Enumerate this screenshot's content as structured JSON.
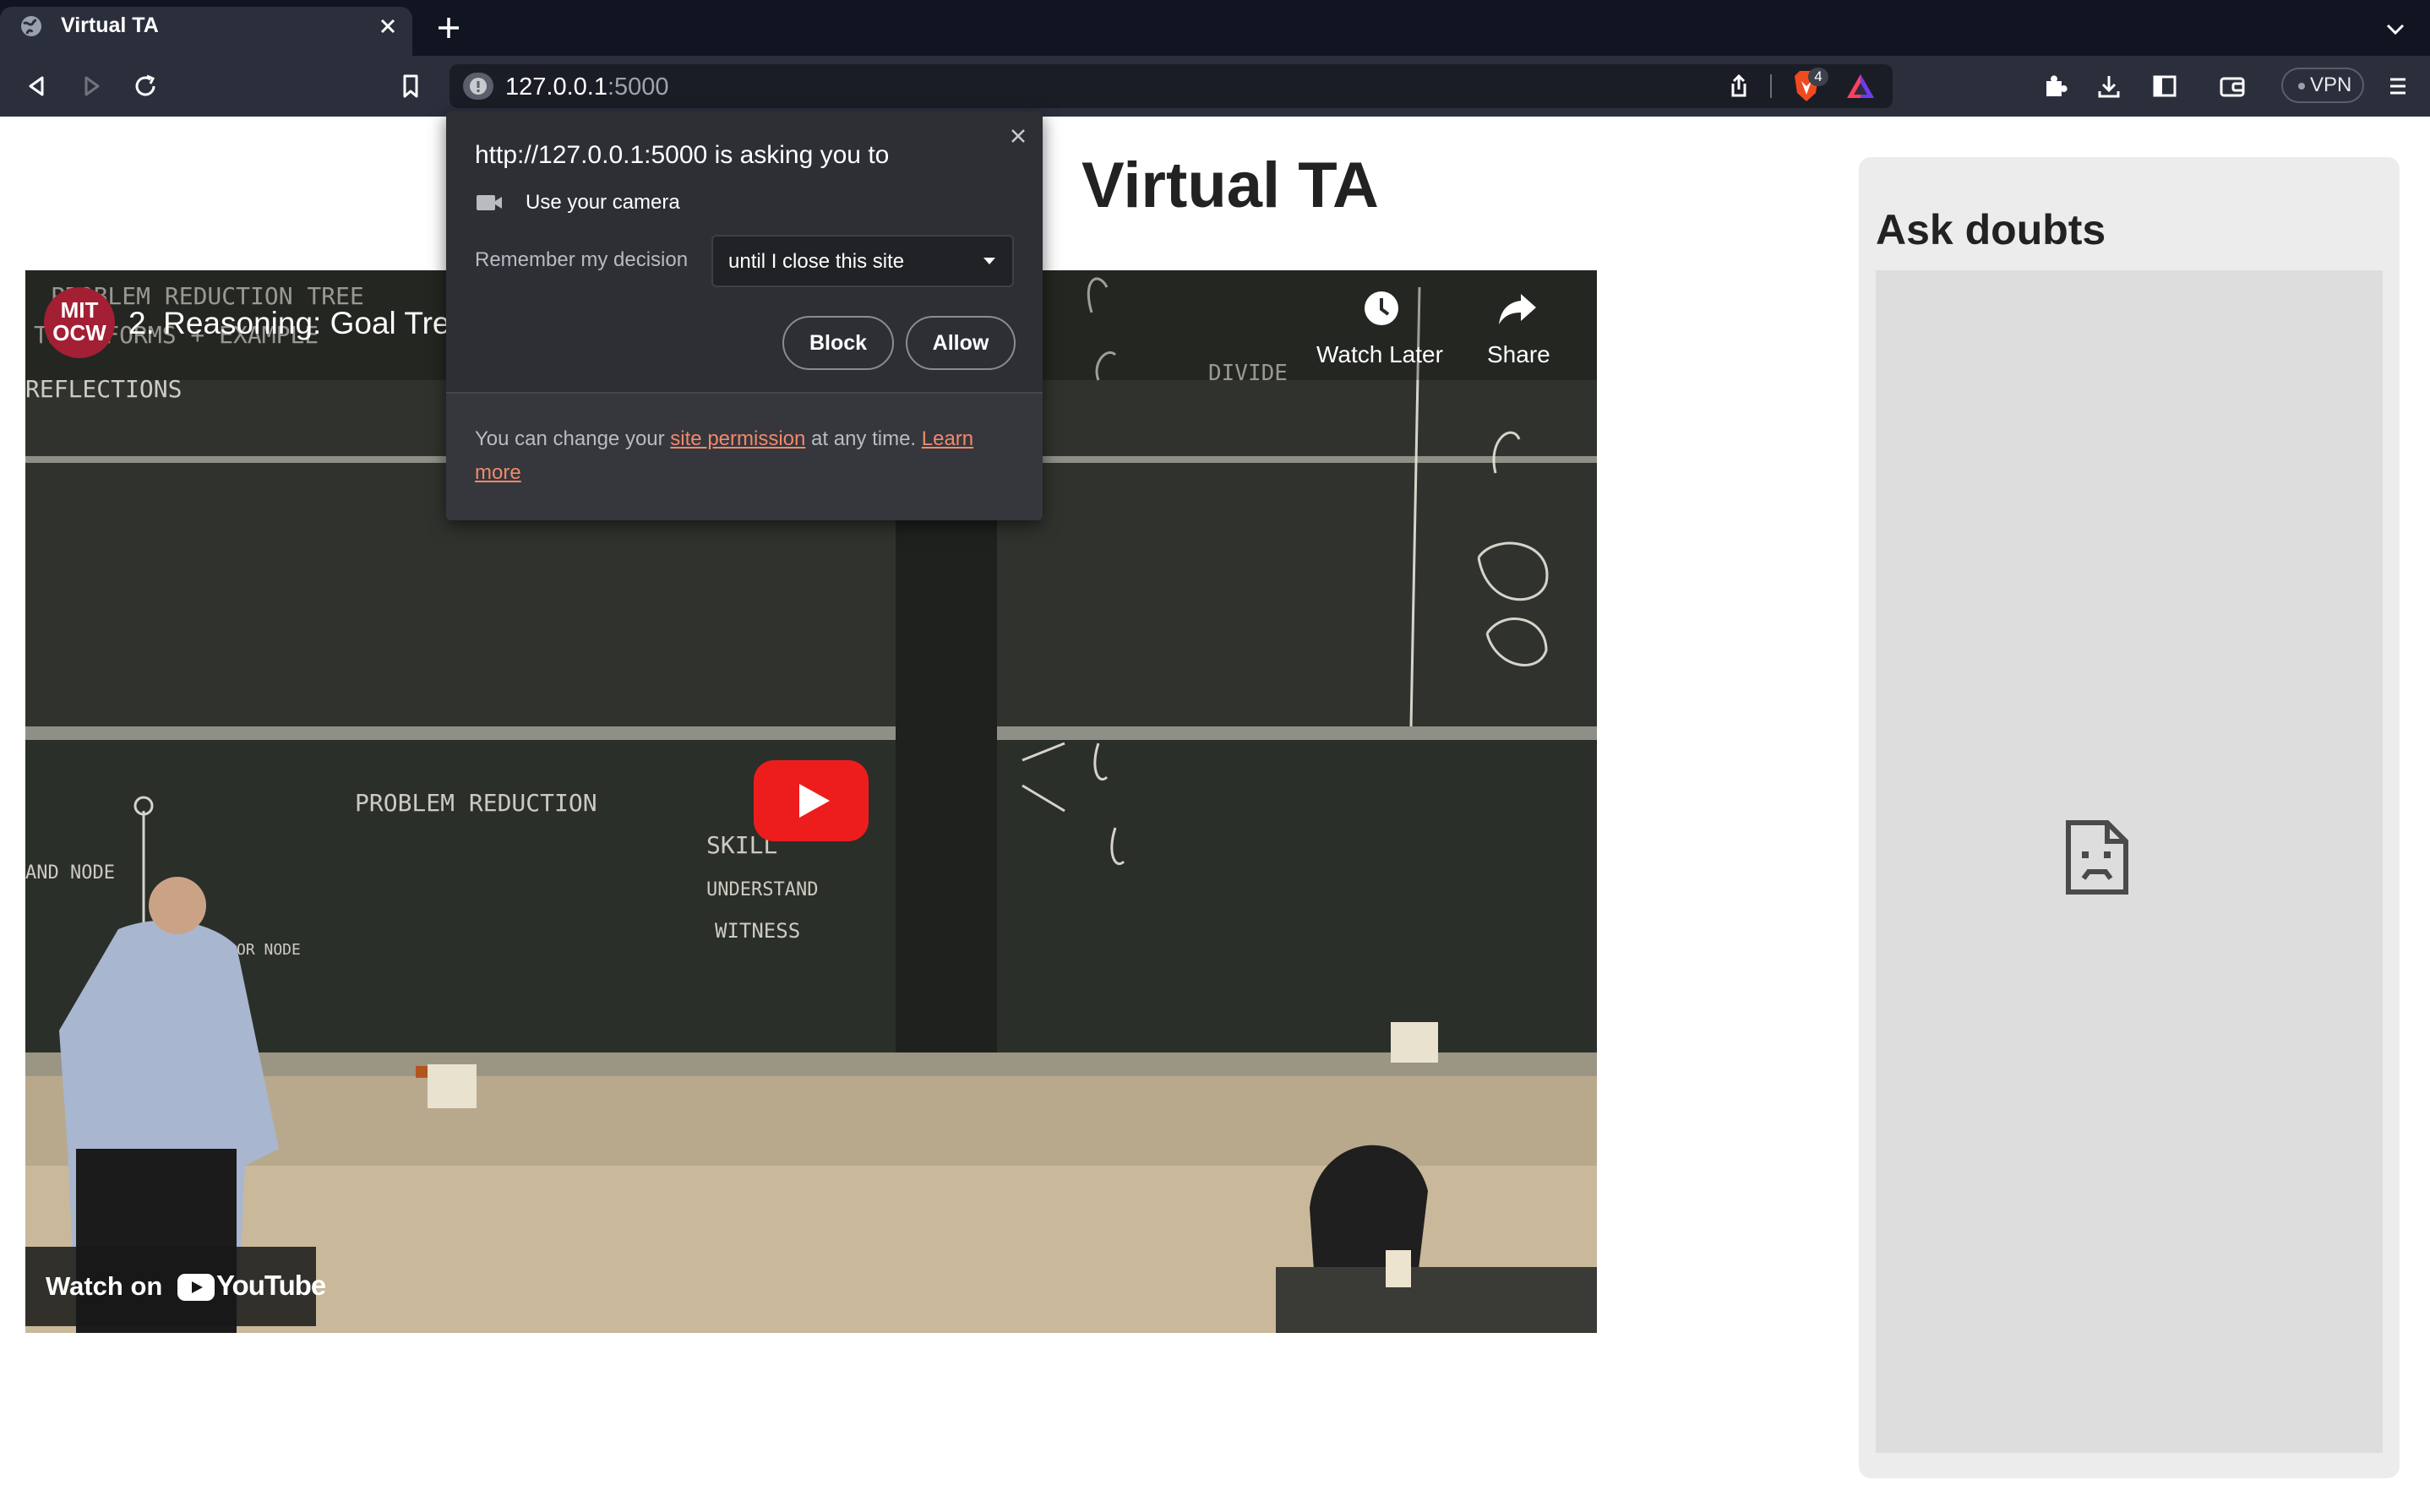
{
  "browser": {
    "tab": {
      "title": "Virtual TA",
      "favicon": "globe-icon"
    },
    "new_tab_icon": "plus-icon",
    "tab_list_icon": "chevron-down-icon",
    "address_bar": {
      "host": "127.0.0.1",
      "port": ":5000"
    },
    "shields_badge": "4",
    "vpn_label": "VPN",
    "colors": {
      "tabstrip": "#111522",
      "toolbar": "#2b2f3c",
      "omnibox": "#1b1d26"
    }
  },
  "permission_prompt": {
    "heading": "http://127.0.0.1:5000 is asking you to",
    "request": "Use your camera",
    "remember_label": "Remember my decision",
    "decision_value": "until I close this site",
    "block_label": "Block",
    "allow_label": "Allow",
    "footer": {
      "prefix": "You can change your",
      "link1": "site permission",
      "middle": "at any time.",
      "link2": "Learn more"
    },
    "colors": {
      "background": "#2d2f35",
      "link": "#f08a6a"
    }
  },
  "page": {
    "title": "Virtual TA",
    "sidebar_title": "Ask doubts"
  },
  "video": {
    "channel_badge": "MIT OCW",
    "title": "2. Reasoning: Goal Tree",
    "watch_later_label": "Watch Later",
    "share_label": "Share",
    "watch_on_label": "Watch on",
    "youtube_label": "YouTube",
    "board_text": {
      "top_left_1": "PROBLEM REDUCTION TREE",
      "top_left_2": "TRANSFORMS + EXAMPLE",
      "top_left_3": "REFLECTIONS",
      "mid": "PROBLEM REDUCTION",
      "skill_1": "SKILL",
      "skill_2": "UNDERSTAND",
      "skill_3": "WITNESS",
      "and_node": "AND NODE",
      "or_node": "OR NODE",
      "divide": "DIVIDE"
    },
    "colors": {
      "play_button": "#ee1d1d",
      "badge": "#a31f34"
    }
  }
}
